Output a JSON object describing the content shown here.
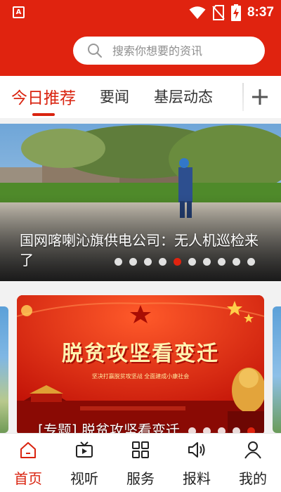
{
  "status_bar": {
    "time": "8:37",
    "left_icon_letter": "A",
    "icons": [
      "app-notification-icon",
      "wifi-icon",
      "no-sim-icon",
      "battery-charging-icon"
    ]
  },
  "search": {
    "placeholder": "搜索你想要的资讯"
  },
  "tabs": [
    {
      "label": "今日推荐",
      "active": true
    },
    {
      "label": "要闻",
      "active": false
    },
    {
      "label": "基层动态",
      "active": false
    }
  ],
  "add_channel_icon": "plus-icon",
  "hero_carousel": {
    "title": "国网喀喇沁旗供电公司：无人机巡检来了",
    "slide_count": 10,
    "active_index": 4
  },
  "feature_carousel": {
    "banner_heading": "脱贫攻坚看变迁",
    "banner_subheading": "坚决打赢脱贫攻坚战  全面建成小康社会",
    "caption": "[专题] 脱贫攻坚看变迁",
    "active_index": 4
  },
  "bottom_nav": [
    {
      "label": "首页",
      "icon": "home-icon",
      "active": true
    },
    {
      "label": "视听",
      "icon": "video-icon",
      "active": false
    },
    {
      "label": "服务",
      "icon": "grid-icon",
      "active": false
    },
    {
      "label": "报料",
      "icon": "speaker-icon",
      "active": false
    },
    {
      "label": "我的",
      "icon": "user-icon",
      "active": false
    }
  ],
  "colors": {
    "brand_red": "#e0230f",
    "active_text": "#d9230f"
  }
}
